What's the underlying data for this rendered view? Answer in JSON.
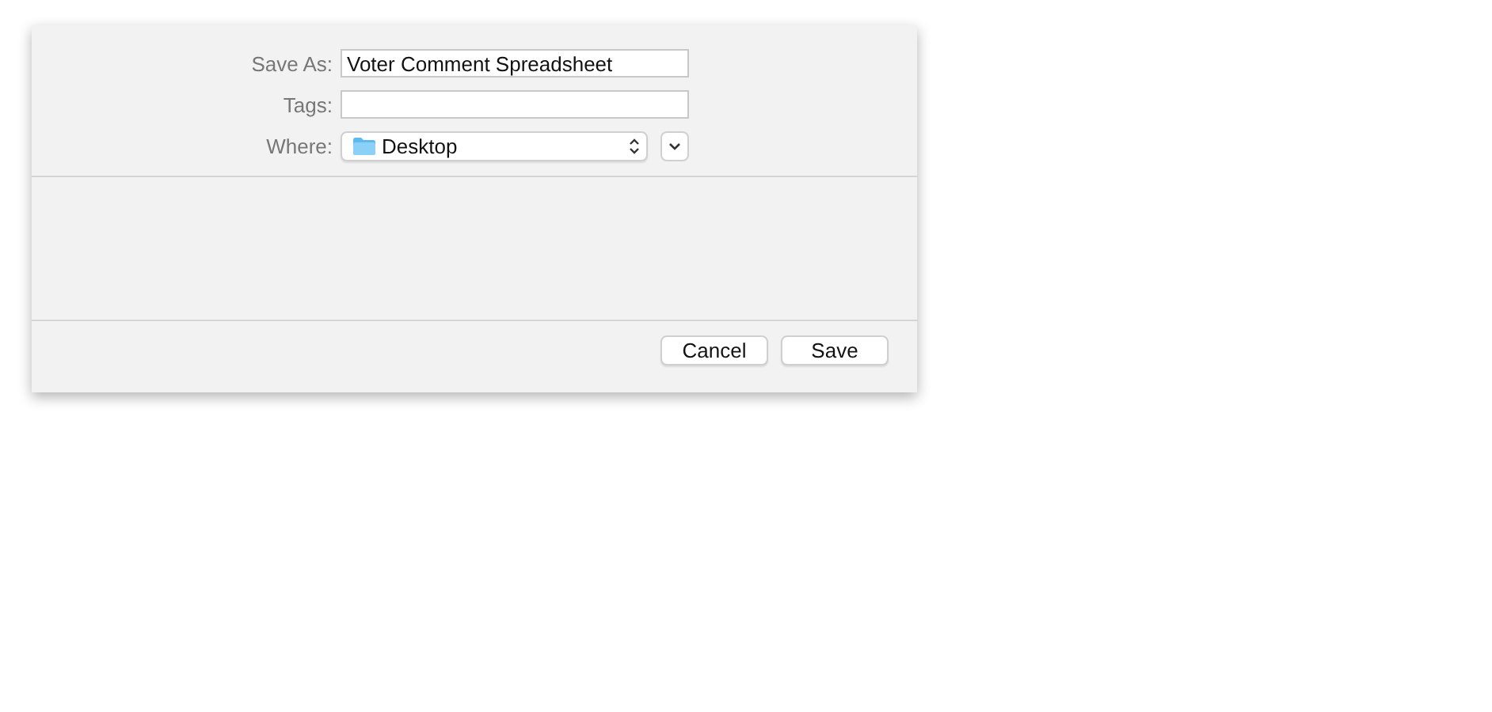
{
  "save_as": {
    "label": "Save As:",
    "value": "Voter Comment Spreadsheet"
  },
  "tags": {
    "label": "Tags:"
  },
  "where": {
    "label": "Where:",
    "value": "Desktop"
  },
  "buttons": [
    {
      "label": "Cancel"
    },
    {
      "label": "Save"
    }
  ]
}
